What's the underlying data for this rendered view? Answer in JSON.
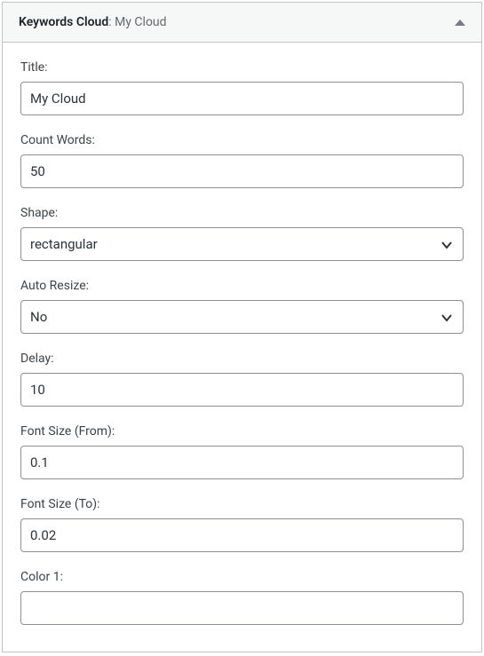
{
  "header": {
    "title_prefix": "Keywords Cloud",
    "title_separator": ": ",
    "title_name": "My Cloud"
  },
  "fields": {
    "title": {
      "label": "Title:",
      "value": "My Cloud"
    },
    "count_words": {
      "label": "Count Words:",
      "value": "50"
    },
    "shape": {
      "label": "Shape:",
      "value": "rectangular"
    },
    "auto_resize": {
      "label": "Auto Resize:",
      "value": "No"
    },
    "delay": {
      "label": "Delay:",
      "value": "10"
    },
    "font_size_from": {
      "label": "Font Size (From):",
      "value": "0.1"
    },
    "font_size_to": {
      "label": "Font Size (To):",
      "value": "0.02"
    },
    "color_1": {
      "label": "Color 1:",
      "value": ""
    }
  }
}
